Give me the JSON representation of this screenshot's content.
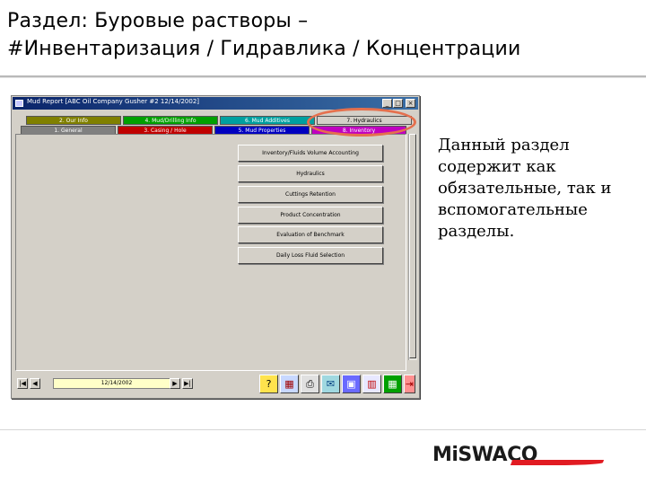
{
  "slide": {
    "title_line1": "Раздел: Буровые растворы –",
    "title_line2": "#Инвентаризация / Гидравлика / Концентрации",
    "side_text": "Данный раздел содержит как обязательные, так и вспомогательные разделы.",
    "logo_text": "MiSWACO"
  },
  "window": {
    "title": "Mud Report [ABC Oil Company  Gusher #2  12/14/2002]",
    "buttons": [
      "_",
      "□",
      "×"
    ]
  },
  "tabs": {
    "row1": [
      {
        "label": "2. Our Info",
        "color": "#808000"
      },
      {
        "label": "4. Mud/Drilling Info",
        "color": "#00a000"
      },
      {
        "label": "6. Mud Additives",
        "color": "#00a0a0"
      },
      {
        "label": "7. Hydraulics",
        "color": "#d4d0c8"
      }
    ],
    "row2": [
      {
        "label": "1. General",
        "color": "#808080"
      },
      {
        "label": "3. Casing / Hole",
        "color": "#c00000"
      },
      {
        "label": "5. Mud Properties",
        "color": "#0000c0"
      },
      {
        "label": "8. Inventory",
        "color": "#c000c0"
      }
    ]
  },
  "menu": [
    "Inventory/Fluids Volume Accounting",
    "Hydraulics",
    "Cuttings Retention",
    "Product Concentration",
    "Evaluation of Benchmark",
    "Daily Loss Fluid Selection"
  ],
  "status": {
    "date": "12/14/2002",
    "nav": [
      "|◀",
      "◀",
      "▶",
      "▶|"
    ]
  },
  "toolbar": {
    "icons": [
      "help-icon",
      "calculator-icon",
      "print-icon",
      "report-icon",
      "save-icon",
      "chart-icon",
      "grid-icon",
      "exit-icon"
    ]
  },
  "colors": {
    "highlight": "#e5704d",
    "window_face": "#d4d0c8"
  }
}
